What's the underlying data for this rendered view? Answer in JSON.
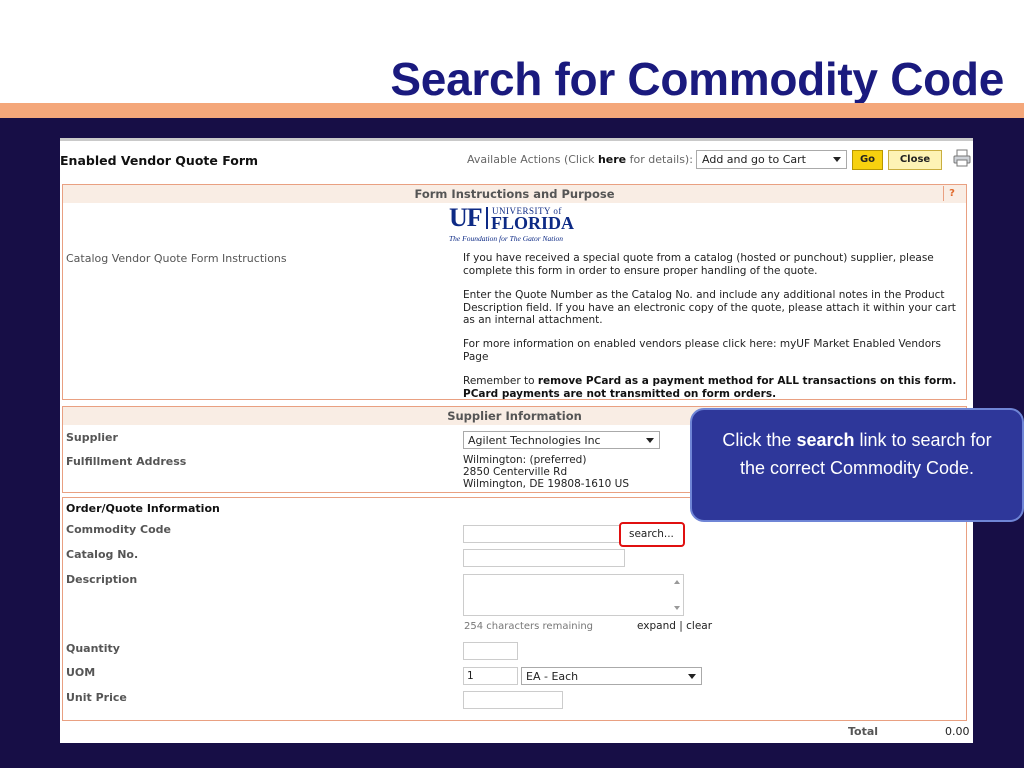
{
  "slide": {
    "title": "Search for Commodity Code"
  },
  "form": {
    "title": "Enabled Vendor Quote Form",
    "actions_prefix": "Available Actions (Click ",
    "actions_here": "here",
    "actions_suffix": " for details):",
    "actions_selected": "Add and go to Cart",
    "go_label": "Go",
    "close_label": "Close"
  },
  "instructions": {
    "header": "Form Instructions and Purpose",
    "help": "?",
    "left_label": "Catalog Vendor Quote Form Instructions",
    "logo": {
      "uf": "UF",
      "university": "UNIVERSITY of",
      "florida": "FLORIDA",
      "tagline": "The Foundation for The Gator Nation"
    },
    "para1": "If you have received a special quote from a catalog (hosted or punchout) supplier, please complete this form in order to ensure proper handling of the quote.",
    "para2": "Enter the Quote Number as the Catalog No. and include any additional notes in the Product Description field. If you have an electronic copy of the quote, please attach it within your cart as an internal attachment.",
    "para3": "For more information on enabled vendors please click here: myUF Market Enabled Vendors Page",
    "para4_prefix": "Remember to ",
    "para4_bold": "remove PCard as a payment method for ALL transactions on this form. PCard payments are not transmitted on form orders."
  },
  "supplier": {
    "header": "Supplier Information",
    "supplier_label": "Supplier",
    "supplier_value": "Agilent Technologies Inc",
    "address_label": "Fulfillment Address",
    "address_line1": "Wilmington: (preferred)",
    "address_line2": "2850 Centerville Rd",
    "address_line3": "Wilmington, DE 19808-1610 US"
  },
  "order": {
    "header": "Order/Quote Information",
    "commodity_label": "Commodity Code",
    "search_label": "search...",
    "catalog_label": "Catalog No.",
    "description_label": "Description",
    "chars_remaining": "254 characters remaining",
    "expand": "expand",
    "separator": " | ",
    "clear": "clear",
    "quantity_label": "Quantity",
    "uom_label": "UOM",
    "uom_qty": "1",
    "uom_value": "EA - Each",
    "unit_price_label": "Unit Price",
    "total_label": "Total",
    "total_value": "0.00"
  },
  "callout": {
    "prefix": "Click the ",
    "bold": "search",
    "suffix": " link to search for the correct Commodity Code."
  },
  "colors": {
    "title": "#1a1a7e",
    "orange_bar": "#f4a77a",
    "background": "#170e46",
    "callout_fill": "#2e379a",
    "highlight": "#e01010"
  },
  "icons": [
    "printer-icon",
    "chevron-down-icon",
    "help-icon"
  ]
}
